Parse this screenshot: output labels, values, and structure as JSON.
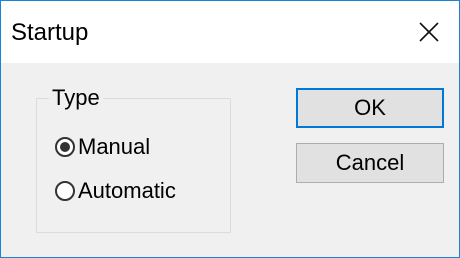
{
  "window": {
    "title": "Startup",
    "close_icon": "close-icon"
  },
  "group": {
    "label": "Type",
    "options": [
      {
        "label": "Manual",
        "selected": true
      },
      {
        "label": "Automatic",
        "selected": false
      }
    ]
  },
  "buttons": {
    "ok_label": "OK",
    "cancel_label": "Cancel"
  },
  "colors": {
    "accent": "#0078d7",
    "window_border": "#1883d7",
    "client_bg": "#f0f0f0",
    "button_bg": "#e1e1e1"
  }
}
